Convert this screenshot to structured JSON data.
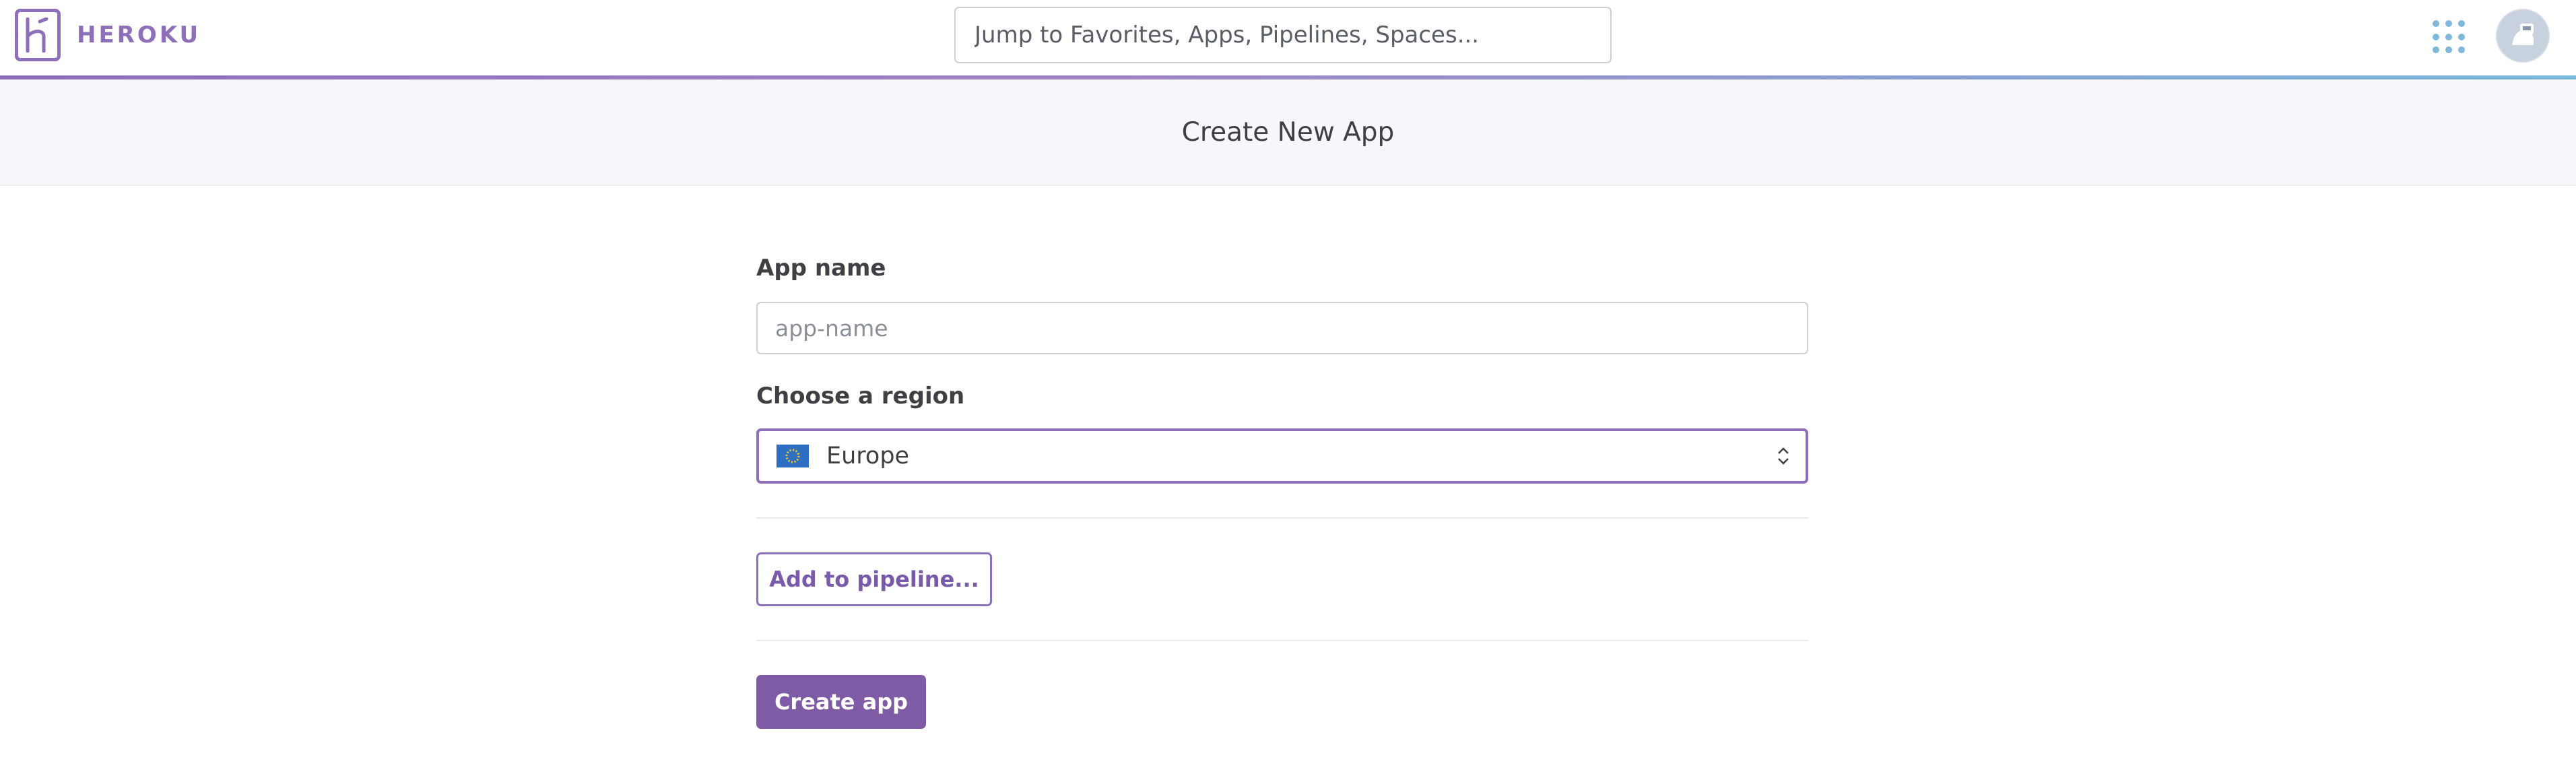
{
  "brand": {
    "name": "HEROKU",
    "logo_icon": "heroku-logo-icon",
    "accent_color": "#8e6fb9"
  },
  "header": {
    "search_placeholder": "Jump to Favorites, Apps, Pipelines, Spaces...",
    "apps_icon": "grid-dots-icon",
    "avatar_icon": "user-avatar-icon"
  },
  "page": {
    "title": "Create New App"
  },
  "form": {
    "app_name_label": "App name",
    "app_name_placeholder": "app-name",
    "app_name_value": "",
    "region_label": "Choose a region",
    "region_selected": "Europe",
    "region_flag_icon": "eu-flag-icon",
    "region_chevron_icon": "up-down-chevron-icon",
    "add_pipeline_label": "Add to pipeline...",
    "create_app_label": "Create app"
  }
}
